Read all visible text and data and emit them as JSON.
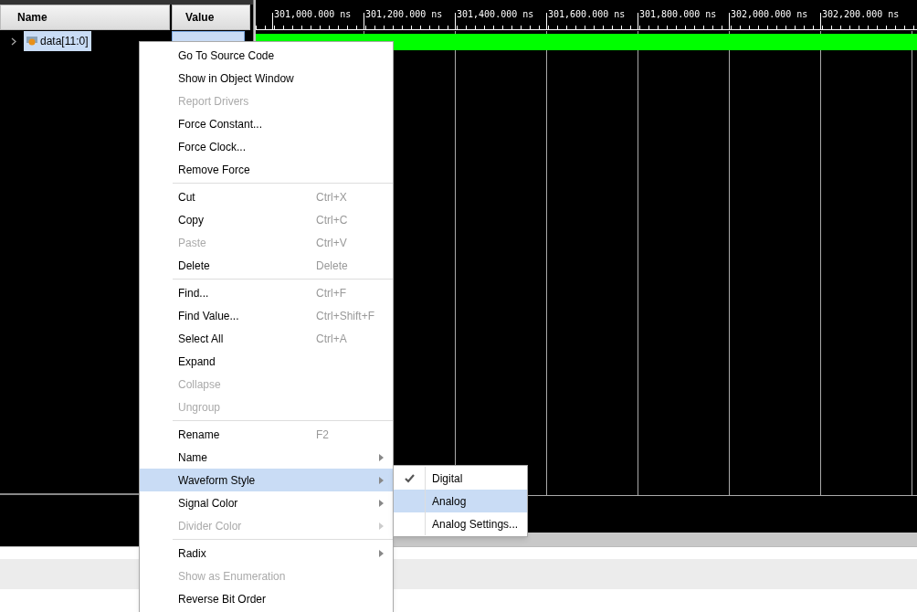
{
  "columns": [
    {
      "label": "Name"
    },
    {
      "label": "Value"
    }
  ],
  "signal": {
    "name": "data[11:0]",
    "selected": true,
    "expanded": false
  },
  "ruler": {
    "labels": [
      "301,000.000 ns",
      "301,200.000 ns",
      "301,400.000 ns",
      "301,600.000 ns",
      "301,800.000 ns",
      "302,000.000 ns",
      "302,200.000 ns"
    ]
  },
  "context_menu": {
    "groups": [
      [
        {
          "label": "Go To Source Code",
          "disabled": false
        },
        {
          "label": "Show in Object Window",
          "disabled": false
        },
        {
          "label": "Report Drivers",
          "disabled": true
        },
        {
          "label": "Force Constant...",
          "disabled": false
        },
        {
          "label": "Force Clock...",
          "disabled": false
        },
        {
          "label": "Remove Force",
          "disabled": false
        }
      ],
      [
        {
          "label": "Cut",
          "shortcut": "Ctrl+X",
          "disabled": false
        },
        {
          "label": "Copy",
          "shortcut": "Ctrl+C",
          "disabled": false
        },
        {
          "label": "Paste",
          "shortcut": "Ctrl+V",
          "disabled": true
        },
        {
          "label": "Delete",
          "shortcut": "Delete",
          "disabled": false
        }
      ],
      [
        {
          "label": "Find...",
          "shortcut": "Ctrl+F",
          "disabled": false
        },
        {
          "label": "Find Value...",
          "shortcut": "Ctrl+Shift+F",
          "disabled": false
        },
        {
          "label": "Select All",
          "shortcut": "Ctrl+A",
          "disabled": false
        },
        {
          "label": "Expand",
          "disabled": false
        },
        {
          "label": "Collapse",
          "disabled": true
        },
        {
          "label": "Ungroup",
          "disabled": true
        }
      ],
      [
        {
          "label": "Rename",
          "shortcut": "F2",
          "disabled": false
        },
        {
          "label": "Name",
          "submenu": true,
          "disabled": false
        },
        {
          "label": "Waveform Style",
          "submenu": true,
          "selected": true,
          "disabled": false
        },
        {
          "label": "Signal Color",
          "submenu": true,
          "disabled": false
        },
        {
          "label": "Divider Color",
          "submenu": true,
          "disabled": true
        }
      ],
      [
        {
          "label": "Radix",
          "submenu": true,
          "disabled": false
        },
        {
          "label": "Show as Enumeration",
          "disabled": true
        },
        {
          "label": "Reverse Bit Order",
          "disabled": false
        }
      ]
    ]
  },
  "submenu": [
    {
      "label": "Digital",
      "checked": true,
      "selected": false
    },
    {
      "label": "Analog",
      "checked": false,
      "selected": true
    },
    {
      "label": "Analog Settings...",
      "checked": false,
      "selected": false
    }
  ]
}
